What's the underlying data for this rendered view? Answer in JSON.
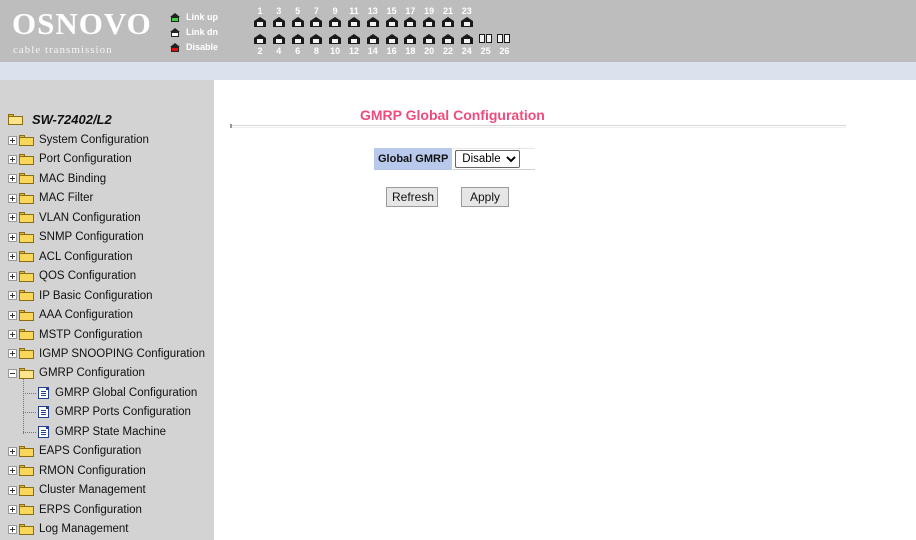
{
  "header": {
    "brand": "OSNOVO",
    "tagline": "cable transmission",
    "legend": [
      {
        "label": "Link up",
        "color": "#3fd13f"
      },
      {
        "label": "Link dn",
        "color": "#ffffff"
      },
      {
        "label": "Disable",
        "color": "#e01010"
      }
    ],
    "ports_top": [
      "1",
      "3",
      "5",
      "7",
      "9",
      "11",
      "13",
      "15",
      "17",
      "19",
      "21",
      "23"
    ],
    "ports_bottom": [
      "2",
      "4",
      "6",
      "8",
      "10",
      "12",
      "14",
      "16",
      "18",
      "20",
      "22",
      "24",
      "25",
      "26"
    ]
  },
  "sidebar": {
    "root": "SW-72402/L2",
    "items": [
      {
        "label": "System Configuration"
      },
      {
        "label": "Port Configuration"
      },
      {
        "label": "MAC Binding"
      },
      {
        "label": "MAC Filter"
      },
      {
        "label": "VLAN Configuration"
      },
      {
        "label": "SNMP Configuration"
      },
      {
        "label": "ACL Configuration"
      },
      {
        "label": "QOS Configuration"
      },
      {
        "label": "IP Basic Configuration"
      },
      {
        "label": "AAA Configuration"
      },
      {
        "label": "MSTP Configuration"
      },
      {
        "label": "IGMP SNOOPING Configuration"
      },
      {
        "label": "GMRP Configuration"
      }
    ],
    "gmrp_children": [
      {
        "label": "GMRP Global Configuration"
      },
      {
        "label": "GMRP Ports Configuration"
      },
      {
        "label": "GMRP State Machine"
      }
    ],
    "items_after": [
      {
        "label": "EAPS Configuration"
      },
      {
        "label": "RMON Configuration"
      },
      {
        "label": "Cluster Management"
      },
      {
        "label": "ERPS Configuration"
      },
      {
        "label": "Log Management"
      }
    ]
  },
  "main": {
    "title": "GMRP Global Configuration",
    "field_label": "Global GMRP",
    "select_value": "Disable",
    "refresh_label": "Refresh",
    "apply_label": "Apply"
  }
}
